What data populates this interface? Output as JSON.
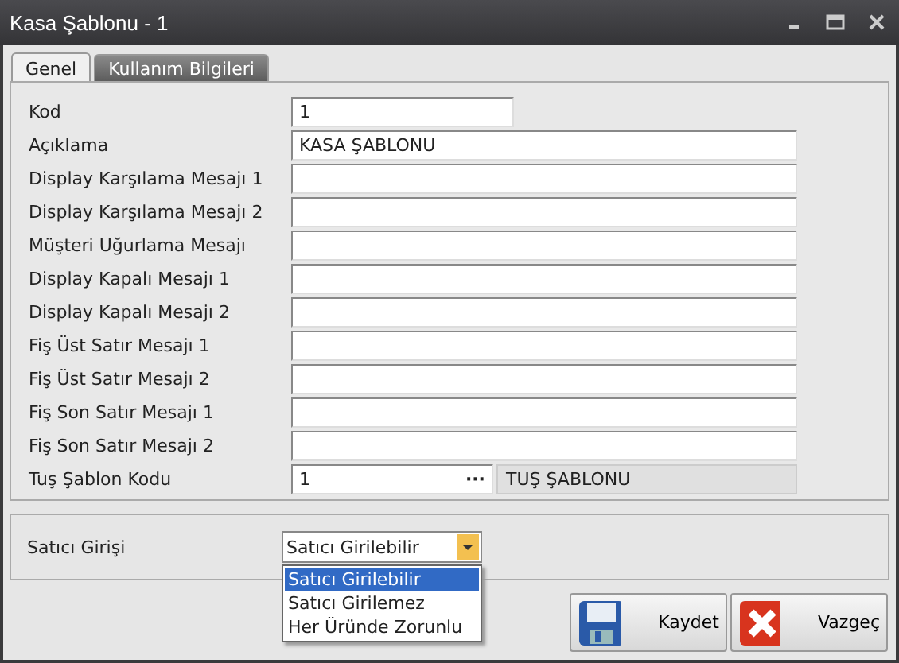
{
  "window": {
    "title": "Kasa Şablonu - 1"
  },
  "tabs": [
    {
      "label": "Genel",
      "selected": true
    },
    {
      "label": "Kullanım Bilgileri",
      "selected": false
    }
  ],
  "fields": [
    {
      "kind": "short",
      "label": "Kod",
      "value": "1"
    },
    {
      "kind": "text",
      "label": "Açıklama",
      "value": "KASA ŞABLONU"
    },
    {
      "kind": "text",
      "label": "Display Karşılama Mesajı 1"
    },
    {
      "kind": "text",
      "label": "Display Karşılama Mesajı 2"
    },
    {
      "kind": "text",
      "label": "Müşteri Uğurlama Mesajı"
    },
    {
      "kind": "text",
      "label": "Display Kapalı Mesajı 1"
    },
    {
      "kind": "text",
      "label": "Display Kapalı Mesajı 2"
    },
    {
      "kind": "text",
      "label": "Fiş Üst Satır Mesajı 1"
    },
    {
      "kind": "text",
      "label": "Fiş Üst Satır Mesajı 2"
    },
    {
      "kind": "text",
      "label": "Fiş Son Satır Mesajı 1"
    },
    {
      "kind": "text",
      "label": "Fiş Son Satır Mesajı 2"
    },
    {
      "kind": "lookup",
      "label": "Tuş Şablon Kodu",
      "value": "1",
      "button": "···",
      "description": "TUŞ ŞABLONU"
    }
  ],
  "dropdown": {
    "label": "Satıcı Girişi",
    "value": "Satıcı Girilebilir",
    "expanded": true,
    "options": [
      {
        "label": "Satıcı Girilebilir",
        "selected": true
      },
      {
        "label": "Satıcı Girilemez",
        "selected": false
      },
      {
        "label": "Her Üründe Zorunlu",
        "selected": false
      }
    ]
  },
  "buttons": [
    {
      "kind": "save",
      "label": "Kaydet"
    },
    {
      "kind": "cancel",
      "label": "Vazgeç"
    }
  ]
}
